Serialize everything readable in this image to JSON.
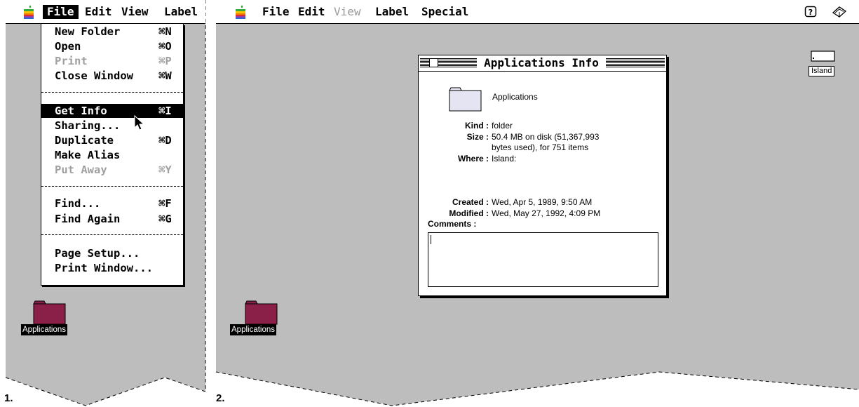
{
  "colors": {
    "desktop": "#bdbdbd",
    "folder": "#8a1f47",
    "menu_highlight": "#000000"
  },
  "panel1": {
    "number": "1.",
    "menubar": {
      "items": [
        {
          "label": "File",
          "state": "selected"
        },
        {
          "label": "Edit",
          "state": "normal"
        },
        {
          "label": "View",
          "state": "normal"
        },
        {
          "label": "Label",
          "state": "normal"
        }
      ]
    },
    "file_menu": {
      "items": [
        {
          "label": "New Folder",
          "shortcut": "⌘N",
          "state": "enabled"
        },
        {
          "label": "Open",
          "shortcut": "⌘O",
          "state": "enabled"
        },
        {
          "label": "Print",
          "shortcut": "⌘P",
          "state": "disabled"
        },
        {
          "label": "Close Window",
          "shortcut": "⌘W",
          "state": "enabled"
        },
        {
          "label": "Get Info",
          "shortcut": "⌘I",
          "state": "highlighted"
        },
        {
          "label": "Sharing...",
          "shortcut": "",
          "state": "enabled"
        },
        {
          "label": "Duplicate",
          "shortcut": "⌘D",
          "state": "enabled"
        },
        {
          "label": "Make Alias",
          "shortcut": "",
          "state": "enabled"
        },
        {
          "label": "Put Away",
          "shortcut": "⌘Y",
          "state": "disabled"
        },
        {
          "label": "Find...",
          "shortcut": "⌘F",
          "state": "enabled"
        },
        {
          "label": "Find Again",
          "shortcut": "⌘G",
          "state": "enabled"
        },
        {
          "label": "Page Setup...",
          "shortcut": "",
          "state": "enabled"
        },
        {
          "label": "Print Window...",
          "shortcut": "",
          "state": "enabled"
        }
      ]
    },
    "desktop_icon": {
      "label": "Applications",
      "icon": "folder-icon"
    }
  },
  "panel2": {
    "number": "2.",
    "menubar": {
      "items": [
        {
          "label": "File",
          "state": "normal"
        },
        {
          "label": "Edit",
          "state": "normal"
        },
        {
          "label": "View",
          "state": "disabled"
        },
        {
          "label": "Label",
          "state": "normal"
        },
        {
          "label": "Special",
          "state": "normal"
        }
      ],
      "right_icons": [
        "help-icon",
        "application-menu-icon"
      ]
    },
    "info_window": {
      "title": "Applications Info",
      "item_name": "Applications",
      "fields": [
        {
          "key": "Kind :",
          "value": "folder"
        },
        {
          "key": "Size :",
          "value": "50.4 MB on disk (51,367,993",
          "value2": "bytes used), for 751 items"
        },
        {
          "key": "Where :",
          "value": "Island:"
        },
        {
          "key": "Created :",
          "value": "Wed, Apr 5, 1989, 9:50 AM"
        },
        {
          "key": "Modified :",
          "value": "Wed, May 27, 1992, 4:09 PM"
        }
      ],
      "comments_label": "Comments :",
      "comments_value": ""
    },
    "volume": {
      "label": "Island",
      "icon": "hard-disk-icon"
    },
    "desktop_icon": {
      "label": "Applications",
      "icon": "folder-icon"
    }
  }
}
